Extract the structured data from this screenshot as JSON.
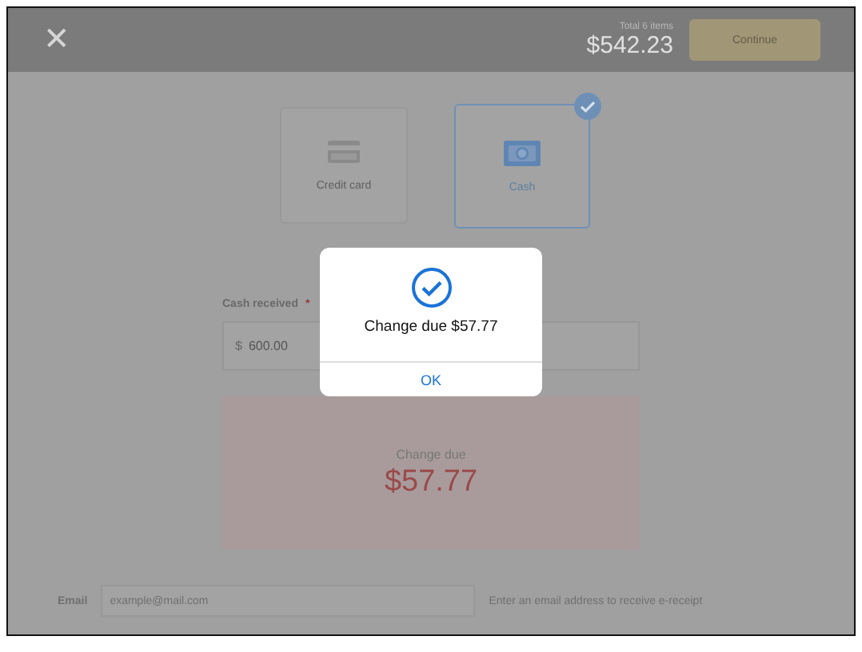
{
  "header": {
    "close_icon": "✕",
    "total_label": "Total 6 items",
    "total": "$542.23",
    "continue_button": {
      "label": "Continue",
      "disabled": true
    }
  },
  "payment_methods": [
    {
      "label": "Credit card",
      "kind": "card",
      "selected": false
    },
    {
      "label": "Cash",
      "kind": "cash",
      "selected": true
    }
  ],
  "cash_received": {
    "label": "Cash received",
    "required_mark": "*",
    "currency": "$",
    "value": "600.00"
  },
  "change_panel": {
    "label": "Change due",
    "amount": "$57.77"
  },
  "email": {
    "label": "Email",
    "placeholder": "example@mail.com",
    "hint": "Enter an email address to receive e-receipt"
  },
  "dialog": {
    "message": "Change due $57.77",
    "button": "OK"
  }
}
